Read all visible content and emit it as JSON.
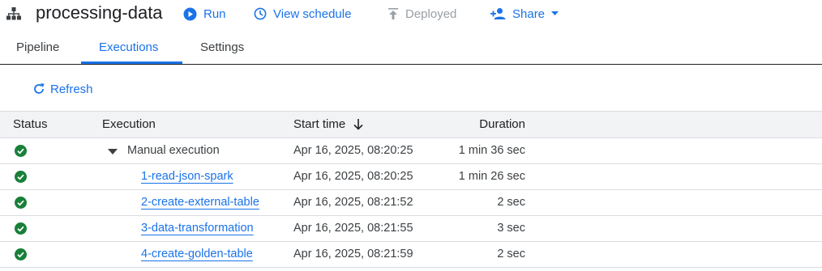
{
  "header": {
    "title": "processing-data",
    "run_label": "Run",
    "schedule_label": "View schedule",
    "deployed_label": "Deployed",
    "share_label": "Share"
  },
  "tabs": [
    {
      "label": "Pipeline",
      "active": false
    },
    {
      "label": "Executions",
      "active": true
    },
    {
      "label": "Settings",
      "active": false
    }
  ],
  "toolbar": {
    "refresh_label": "Refresh"
  },
  "table": {
    "columns": {
      "status": "Status",
      "execution": "Execution",
      "start_time": "Start time",
      "duration": "Duration"
    },
    "sort": "start_time-descending",
    "rows": [
      {
        "status": "success",
        "execution": "Manual execution",
        "start_time": "Apr 16, 2025, 08:20:25",
        "duration": "1 min 36 sec",
        "expanded": true
      },
      {
        "status": "success",
        "execution": "1-read-json-spark",
        "start_time": "Apr 16, 2025, 08:20:25",
        "duration": "1 min 26 sec"
      },
      {
        "status": "success",
        "execution": "2-create-external-table",
        "start_time": "Apr 16, 2025, 08:21:52",
        "duration": "2 sec"
      },
      {
        "status": "success",
        "execution": "3-data-transformation",
        "start_time": "Apr 16, 2025, 08:21:55",
        "duration": "3 sec"
      },
      {
        "status": "success",
        "execution": "4-create-golden-table",
        "start_time": "Apr 16, 2025, 08:21:59",
        "duration": "2 sec"
      }
    ]
  },
  "colors": {
    "accent": "#1a73e8",
    "success": "#188038",
    "disabled": "#9aa0a6",
    "header_bg": "#f1f3f4"
  }
}
